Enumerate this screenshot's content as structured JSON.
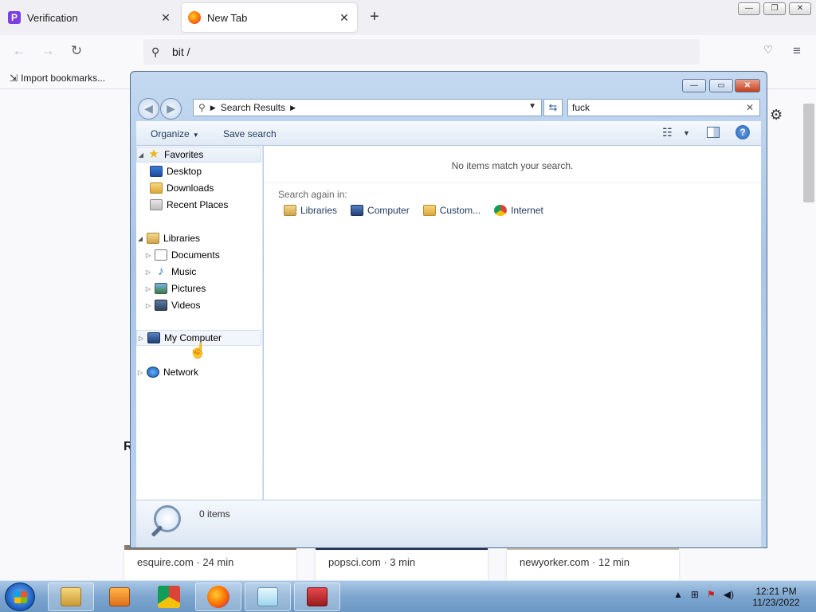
{
  "browser": {
    "tabs": [
      {
        "title": "Verification",
        "active": false
      },
      {
        "title": "New Tab",
        "active": true
      }
    ],
    "tab_close": "✕",
    "new_tab": "+",
    "window_controls": {
      "minimize": "—",
      "restore": "❐",
      "close": "✕"
    },
    "url": "bit /",
    "bookmarks_bar": {
      "import_label": "Import bookmarks..."
    },
    "partial_heading": "R",
    "story_cards": [
      {
        "source": "esquire.com · 24 min"
      },
      {
        "source": "popsci.com · 3 min"
      },
      {
        "source": "newyorker.com · 12 min"
      }
    ]
  },
  "explorer": {
    "window_controls": {
      "minimize": "—",
      "maximize": "▭",
      "close": "✕"
    },
    "address": {
      "crumb": "Search Results"
    },
    "search": {
      "query": "fuck",
      "clear": "✕"
    },
    "toolbar": {
      "organize": "Organize",
      "save_search": "Save search"
    },
    "nav_pane": {
      "favorites": {
        "label": "Favorites",
        "items": [
          "Desktop",
          "Downloads",
          "Recent Places"
        ]
      },
      "libraries": {
        "label": "Libraries",
        "items": [
          "Documents",
          "Music",
          "Pictures",
          "Videos"
        ]
      },
      "computer": {
        "label": "My Computer"
      },
      "network": {
        "label": "Network"
      }
    },
    "content": {
      "empty_message": "No items match your search.",
      "search_again_label": "Search again in:",
      "search_again_targets": [
        "Libraries",
        "Computer",
        "Custom...",
        "Internet"
      ]
    },
    "details": {
      "count": "0 items"
    }
  },
  "taskbar": {
    "clock": {
      "time": "12:21 PM",
      "date": "11/23/2022"
    },
    "tray_arrow": "▲"
  },
  "icons": {
    "browser_nav": [
      "back-arrow-icon",
      "forward-arrow-icon",
      "reload-icon"
    ],
    "explorer": [
      "star-icon",
      "desktop-icon",
      "folder-icon",
      "recent-places-icon",
      "library-icon",
      "document-icon",
      "music-note-icon",
      "picture-icon",
      "video-icon",
      "computer-icon",
      "network-icon",
      "chrome-icon",
      "magnifier-icon",
      "help-icon"
    ]
  },
  "colors": {
    "firefox_bg": "#f9f9fb",
    "explorer_frame": "#aac6e6",
    "explorer_close": "#c33f1c",
    "taskbar": "#7da6cf"
  }
}
